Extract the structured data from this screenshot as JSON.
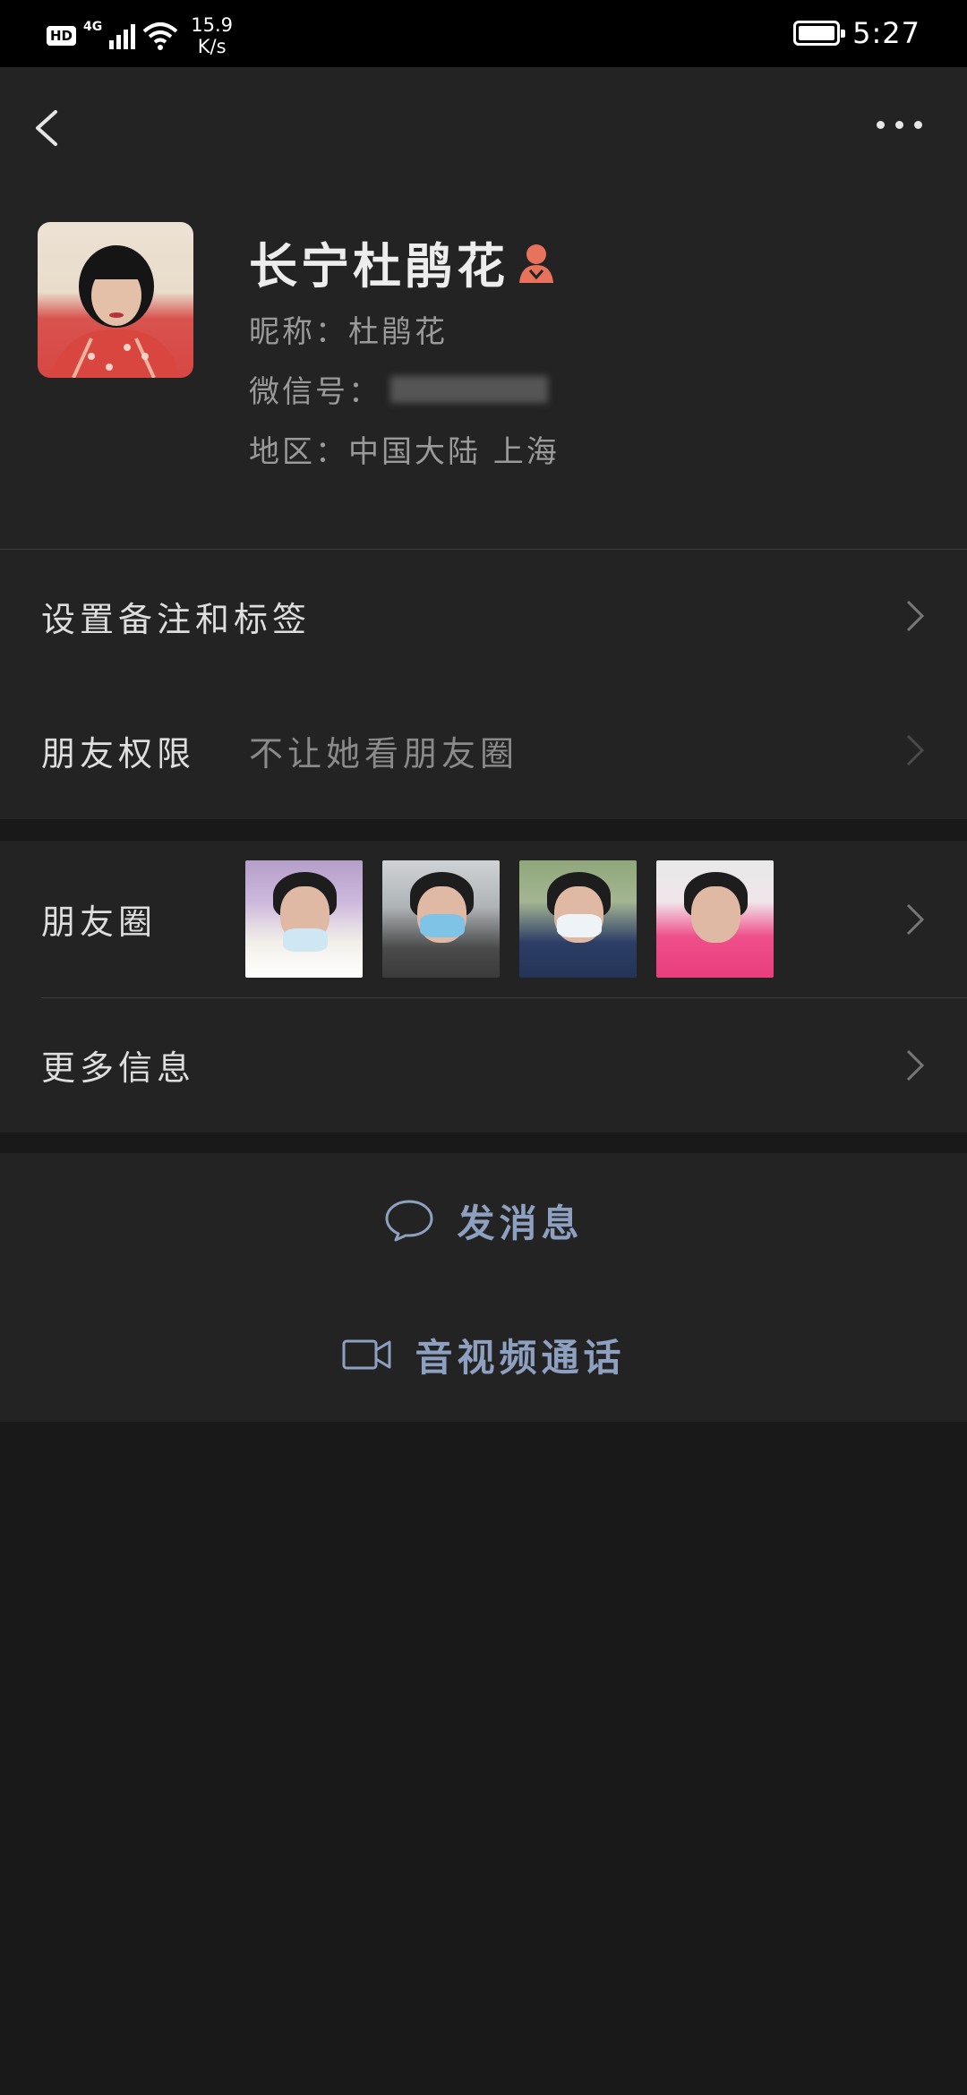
{
  "status_bar": {
    "hd": "HD",
    "network": "4G",
    "speed_value": "15.9",
    "speed_unit": "K/s",
    "time": "5:27"
  },
  "profile": {
    "name": "长宁杜鹃花",
    "nickname": "昵称：杜鹃花",
    "wechat_id_label": "微信号：",
    "region": "地区：中国大陆 上海",
    "gender_icon": "female-icon",
    "gender_color": "#e8735c"
  },
  "list_group1": {
    "remark": "设置备注和标签",
    "permission_label": "朋友权限",
    "permission_value": "不让她看朋友圈"
  },
  "list_group2": {
    "moments_label": "朋友圈",
    "more_info": "更多信息"
  },
  "actions": {
    "message": "发消息",
    "video_call": "音视频通话",
    "accent_color": "#8ea0c0"
  }
}
